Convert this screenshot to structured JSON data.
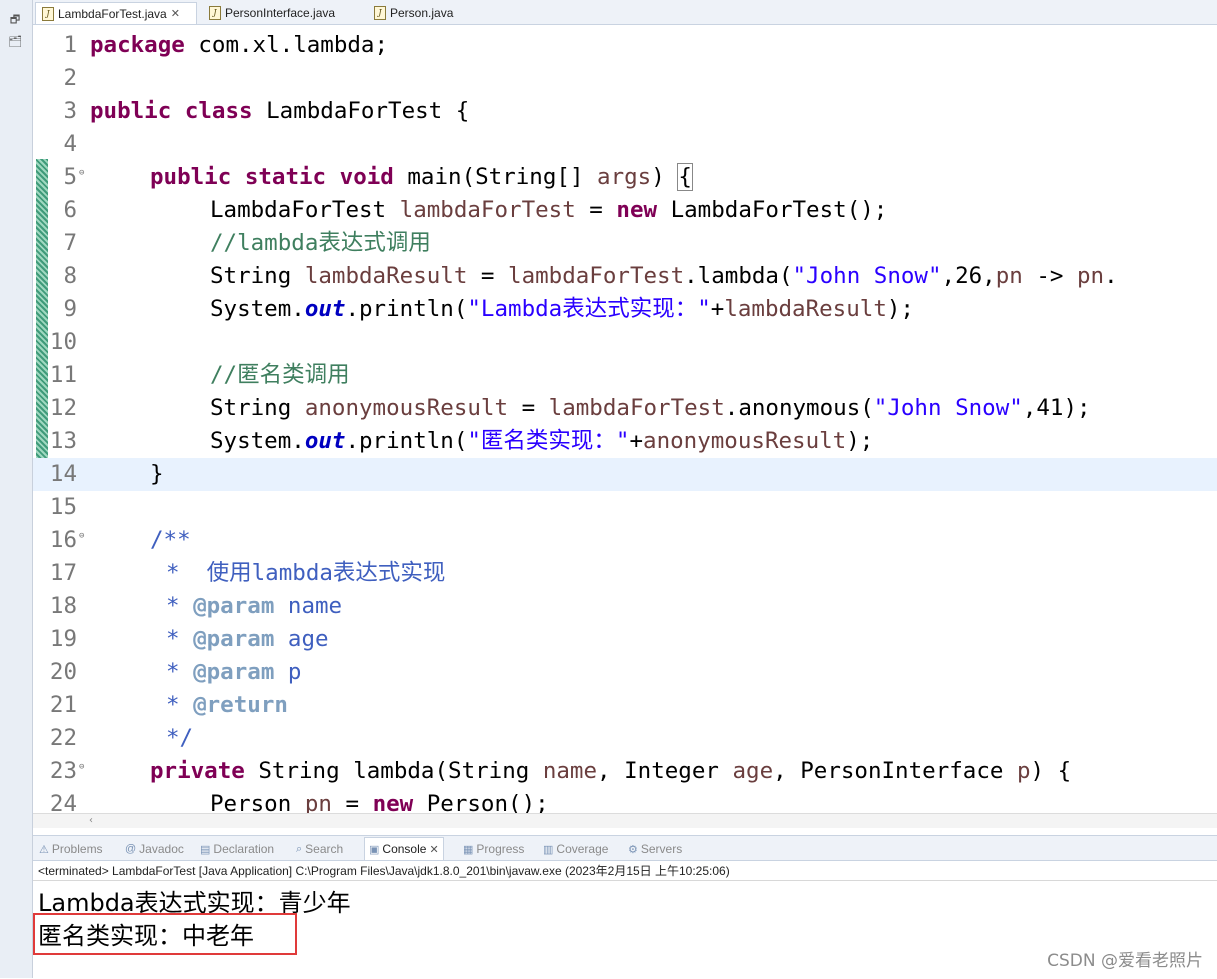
{
  "editor_tabs": [
    {
      "label": "LambdaForTest.java",
      "active": true
    },
    {
      "label": "PersonInterface.java",
      "active": false
    },
    {
      "label": "Person.java",
      "active": false
    }
  ],
  "code_lines": [
    {
      "n": "1",
      "t": "package com.xl.lambda;"
    },
    {
      "n": "2",
      "t": ""
    },
    {
      "n": "3",
      "t": "public class LambdaForTest {"
    },
    {
      "n": "4",
      "t": ""
    },
    {
      "n": "5",
      "t": "public static void main(String[] args) {"
    },
    {
      "n": "6",
      "t": "LambdaForTest lambdaForTest = new LambdaForTest();"
    },
    {
      "n": "7",
      "t": "//lambda表达式调用"
    },
    {
      "n": "8",
      "t": "String lambdaResult = lambdaForTest.lambda(\"John Snow\",26,pn -> pn."
    },
    {
      "n": "9",
      "t": "System.out.println(\"Lambda表达式实现：\"+lambdaResult);"
    },
    {
      "n": "10",
      "t": ""
    },
    {
      "n": "11",
      "t": "//匿名类调用"
    },
    {
      "n": "12",
      "t": "String anonymousResult = lambdaForTest.anonymous(\"John Snow\",41);"
    },
    {
      "n": "13",
      "t": "System.out.println(\"匿名类实现：\"+anonymousResult);"
    },
    {
      "n": "14",
      "t": "}"
    },
    {
      "n": "15",
      "t": ""
    },
    {
      "n": "16",
      "t": "/**"
    },
    {
      "n": "17",
      "t": "*  使用lambda表达式实现"
    },
    {
      "n": "18",
      "t": "* @param name"
    },
    {
      "n": "19",
      "t": "* @param age"
    },
    {
      "n": "20",
      "t": "* @param p"
    },
    {
      "n": "21",
      "t": "* @return"
    },
    {
      "n": "22",
      "t": "*/"
    },
    {
      "n": "23",
      "t": "private String lambda(String name, Integer age, PersonInterface p) {"
    },
    {
      "n": "24",
      "t": "Person pn = new Person();"
    }
  ],
  "view_tabs": [
    {
      "label": "Problems",
      "icon": "problems-icon"
    },
    {
      "label": "Javadoc",
      "icon": "javadoc-icon"
    },
    {
      "label": "Declaration",
      "icon": "declaration-icon"
    },
    {
      "label": "Search",
      "icon": "search-icon"
    },
    {
      "label": "Console",
      "icon": "console-icon",
      "active": true
    },
    {
      "label": "Progress",
      "icon": "progress-icon"
    },
    {
      "label": "Coverage",
      "icon": "coverage-icon"
    },
    {
      "label": "Servers",
      "icon": "servers-icon"
    }
  ],
  "console": {
    "status": "<terminated> LambdaForTest [Java Application] C:\\Program Files\\Java\\jdk1.8.0_201\\bin\\javaw.exe (2023年2月15日 上午10:25:06)",
    "output": [
      "Lambda表达式实现：青少年",
      "匿名类实现：中老年"
    ]
  },
  "watermark": "CSDN @爱看老照片",
  "colors": {
    "keyword": "#7f0055",
    "string": "#2a00ff",
    "comment": "#3f7f5f",
    "javadoc": "#3f5fbf",
    "highlight_box": "#e03a3a"
  }
}
